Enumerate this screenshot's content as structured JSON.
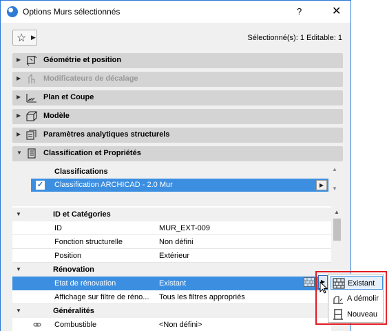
{
  "window": {
    "title": "Options Murs sélectionnés",
    "help": "?",
    "close": "✕"
  },
  "toolbar": {
    "favorites_star": "☆",
    "favorites_arrow": "▶",
    "selection_info": "Sélectionné(s): 1 Editable: 1"
  },
  "panels": [
    {
      "label": "Géométrie et position",
      "expanded": false,
      "disabled": false,
      "icon": "geometry-icon"
    },
    {
      "label": "Modificateurs de décalage",
      "expanded": false,
      "disabled": true,
      "icon": "offset-modifier-icon"
    },
    {
      "label": "Plan et Coupe",
      "expanded": false,
      "disabled": false,
      "icon": "plan-section-icon"
    },
    {
      "label": "Modèle",
      "expanded": false,
      "disabled": false,
      "icon": "model-icon"
    },
    {
      "label": "Paramètres analytiques structurels",
      "expanded": false,
      "disabled": false,
      "icon": "structural-analytics-icon"
    },
    {
      "label": "Classification et Propriétés",
      "expanded": true,
      "disabled": false,
      "icon": "classification-icon"
    }
  ],
  "classifications": {
    "header": "Classifications",
    "row_label": "Classification ARCHICAD - 2.0 Mur",
    "checked": true,
    "check_mark": "✓"
  },
  "properties": {
    "groups": [
      {
        "label": "ID et Catégories",
        "items": [
          {
            "label": "ID",
            "value": "MUR_EXT-009"
          },
          {
            "label": "Fonction structurelle",
            "value": "Non défini"
          },
          {
            "label": "Position",
            "value": "Extérieur"
          }
        ]
      },
      {
        "label": "Rénovation",
        "items": [
          {
            "label": "Etat de rénovation",
            "value": "Existant",
            "selected": true
          },
          {
            "label": "Affichage sur filtre de réno...",
            "value": "Tous les filtres appropriés"
          }
        ]
      },
      {
        "label": "Généralités",
        "items": [
          {
            "label": "Combustible",
            "value": "<Non défini>"
          }
        ]
      }
    ]
  },
  "renovation_popup": {
    "options": [
      {
        "label": "Existant",
        "icon": "existing-wall-icon",
        "active": true
      },
      {
        "label": "A démolir",
        "icon": "demolish-icon",
        "active": false
      },
      {
        "label": "Nouveau",
        "icon": "new-construction-icon",
        "active": false
      }
    ]
  },
  "colors": {
    "selection_blue": "#3c8fe0",
    "highlight_frame": "#e11b22",
    "panel_header": "#d4d4d4"
  }
}
